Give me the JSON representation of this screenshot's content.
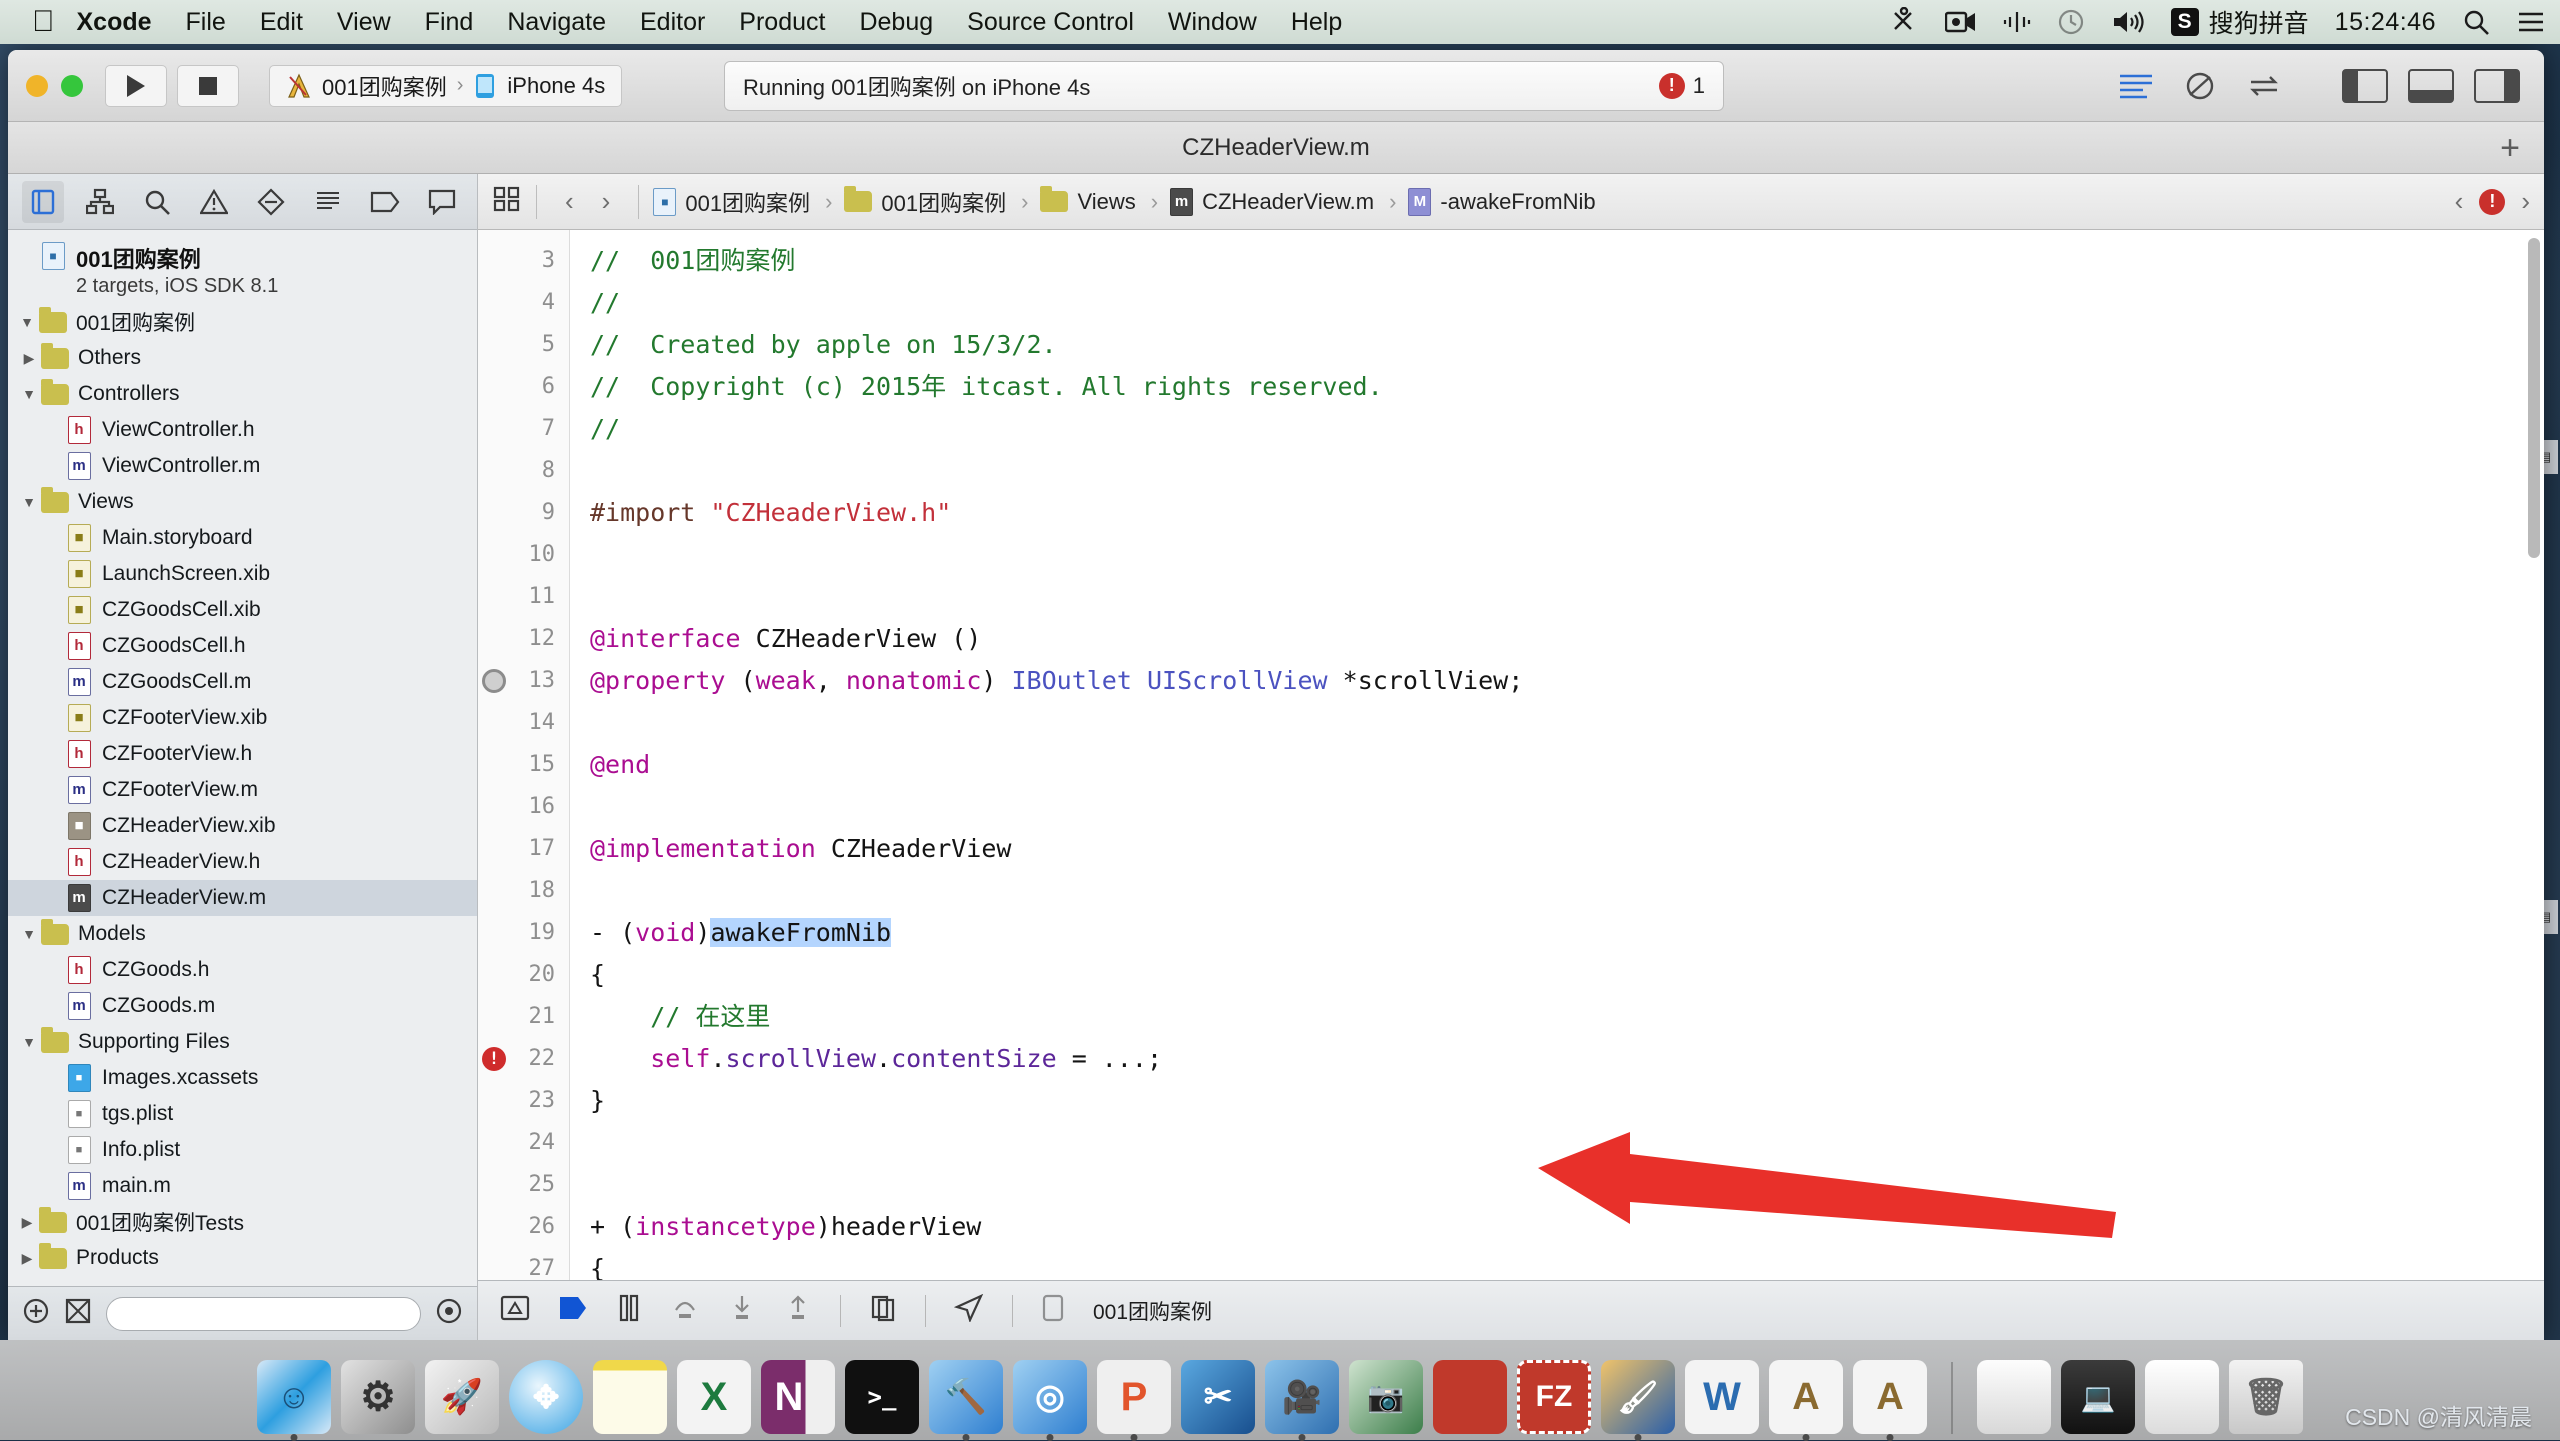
{
  "menubar": {
    "apple_icon": "apple-logo-icon",
    "items": [
      {
        "label": "Xcode",
        "bold": true
      },
      {
        "label": "File",
        "bold": false
      },
      {
        "label": "Edit",
        "bold": false
      },
      {
        "label": "View",
        "bold": false
      },
      {
        "label": "Find",
        "bold": false
      },
      {
        "label": "Navigate",
        "bold": false
      },
      {
        "label": "Editor",
        "bold": false
      },
      {
        "label": "Product",
        "bold": false
      },
      {
        "label": "Debug",
        "bold": false
      },
      {
        "label": "Source Control",
        "bold": false
      },
      {
        "label": "Window",
        "bold": false
      },
      {
        "label": "Help",
        "bold": false
      }
    ],
    "status": {
      "icons": [
        "scissors-icon",
        "screen-record-icon",
        "airplay-icon",
        "time-machine-icon",
        "volume-icon"
      ],
      "input_method_badge": "S",
      "input_method_label": "搜狗拼音",
      "clock": "15:24:46",
      "search_icon": "spotlight-search-icon",
      "notification_icon": "notification-center-icon"
    }
  },
  "toolbar": {
    "run_icon": "run-play-icon",
    "stop_icon": "stop-square-icon",
    "scheme_project": "001团购案例",
    "scheme_device": "iPhone 4s",
    "scheme_chevron": "›",
    "status_text": "Running 001团购案例 on iPhone 4s",
    "error_count": "1",
    "error_badge_glyph": "!",
    "editor_icons": [
      "standard-editor-icon",
      "assistant-editor-icon",
      "version-editor-icon"
    ],
    "pane_icons": [
      "toggle-navigator-icon",
      "toggle-debug-area-icon",
      "toggle-utilities-icon"
    ]
  },
  "titlebar": {
    "title": "CZHeaderView.m",
    "add_tab_label": "+"
  },
  "navigator": {
    "tabs": [
      {
        "name": "project-navigator-tab",
        "active": true
      },
      {
        "name": "symbol-navigator-tab",
        "active": false
      },
      {
        "name": "find-navigator-tab",
        "active": false
      },
      {
        "name": "issue-navigator-tab",
        "active": false
      },
      {
        "name": "test-navigator-tab",
        "active": false
      },
      {
        "name": "debug-navigator-tab",
        "active": false
      },
      {
        "name": "breakpoint-navigator-tab",
        "active": false
      },
      {
        "name": "log-navigator-tab",
        "active": false
      }
    ],
    "project_name": "001团购案例",
    "project_subtitle": "2 targets, iOS SDK 8.1",
    "tree": [
      {
        "label": "001团购案例",
        "kind": "folder",
        "indent": 0,
        "twisty": "down",
        "selected": false
      },
      {
        "label": "Others",
        "kind": "folder",
        "indent": 1,
        "twisty": "right",
        "selected": false
      },
      {
        "label": "Controllers",
        "kind": "folder",
        "indent": 1,
        "twisty": "down",
        "selected": false
      },
      {
        "label": "ViewController.h",
        "kind": "h",
        "indent": 2,
        "twisty": "",
        "selected": false
      },
      {
        "label": "ViewController.m",
        "kind": "m",
        "indent": 2,
        "twisty": "",
        "selected": false
      },
      {
        "label": "Views",
        "kind": "folder",
        "indent": 1,
        "twisty": "down",
        "selected": false
      },
      {
        "label": "Main.storyboard",
        "kind": "sb",
        "indent": 2,
        "twisty": "",
        "selected": false
      },
      {
        "label": "LaunchScreen.xib",
        "kind": "xib",
        "indent": 2,
        "twisty": "",
        "selected": false
      },
      {
        "label": "CZGoodsCell.xib",
        "kind": "xib",
        "indent": 2,
        "twisty": "",
        "selected": false
      },
      {
        "label": "CZGoodsCell.h",
        "kind": "h",
        "indent": 2,
        "twisty": "",
        "selected": false
      },
      {
        "label": "CZGoodsCell.m",
        "kind": "m",
        "indent": 2,
        "twisty": "",
        "selected": false
      },
      {
        "label": "CZFooterView.xib",
        "kind": "xib",
        "indent": 2,
        "twisty": "",
        "selected": false
      },
      {
        "label": "CZFooterView.h",
        "kind": "h",
        "indent": 2,
        "twisty": "",
        "selected": false
      },
      {
        "label": "CZFooterView.m",
        "kind": "m",
        "indent": 2,
        "twisty": "",
        "selected": false
      },
      {
        "label": "CZHeaderView.xib",
        "kind": "gray",
        "indent": 2,
        "twisty": "",
        "selected": false
      },
      {
        "label": "CZHeaderView.h",
        "kind": "h",
        "indent": 2,
        "twisty": "",
        "selected": false
      },
      {
        "label": "CZHeaderView.m",
        "kind": "dark",
        "indent": 2,
        "twisty": "",
        "selected": true
      },
      {
        "label": "Models",
        "kind": "folder",
        "indent": 1,
        "twisty": "down",
        "selected": false
      },
      {
        "label": "CZGoods.h",
        "kind": "h",
        "indent": 2,
        "twisty": "",
        "selected": false
      },
      {
        "label": "CZGoods.m",
        "kind": "m",
        "indent": 2,
        "twisty": "",
        "selected": false
      },
      {
        "label": "Supporting Files",
        "kind": "folder",
        "indent": 1,
        "twisty": "down",
        "selected": false
      },
      {
        "label": "Images.xcassets",
        "kind": "asset",
        "indent": 2,
        "twisty": "",
        "selected": false
      },
      {
        "label": "tgs.plist",
        "kind": "plist",
        "indent": 2,
        "twisty": "",
        "selected": false
      },
      {
        "label": "Info.plist",
        "kind": "plist",
        "indent": 2,
        "twisty": "",
        "selected": false
      },
      {
        "label": "main.m",
        "kind": "m",
        "indent": 2,
        "twisty": "",
        "selected": false
      },
      {
        "label": "001团购案例Tests",
        "kind": "folder",
        "indent": 0,
        "twisty": "right",
        "selected": false
      },
      {
        "label": "Products",
        "kind": "folder",
        "indent": 0,
        "twisty": "right",
        "selected": false
      }
    ],
    "filter_placeholder": "",
    "footer_icons": [
      "add-file-icon",
      "filter-icon",
      "recent-files-icon"
    ]
  },
  "jumpbar": {
    "related_items_icon": "related-items-icon",
    "back_icon": "‹",
    "forward_icon": "›",
    "crumbs": [
      {
        "label": "001团购案例",
        "icon": "project-icon"
      },
      {
        "label": "001团购案例",
        "icon": "folder-icon"
      },
      {
        "label": "Views",
        "icon": "folder-icon"
      },
      {
        "label": "CZHeaderView.m",
        "icon": "m-file-icon"
      },
      {
        "label": "-awakeFromNib",
        "icon": "method-icon"
      }
    ],
    "issue_prev_icon": "‹",
    "issue_count_glyph": "!",
    "issue_next_icon": "›"
  },
  "code": {
    "first_line_number": 3,
    "lines": [
      {
        "n": 3,
        "marker": "",
        "tokens": [
          {
            "t": "//  001团购案例",
            "c": "c-com"
          }
        ]
      },
      {
        "n": 4,
        "marker": "",
        "tokens": [
          {
            "t": "//",
            "c": "c-com"
          }
        ]
      },
      {
        "n": 5,
        "marker": "",
        "tokens": [
          {
            "t": "//  Created by apple on 15/3/2.",
            "c": "c-com"
          }
        ]
      },
      {
        "n": 6,
        "marker": "",
        "tokens": [
          {
            "t": "//  Copyright (c) 2015年 itcast. All rights reserved.",
            "c": "c-com"
          }
        ]
      },
      {
        "n": 7,
        "marker": "",
        "tokens": [
          {
            "t": "//",
            "c": "c-com"
          }
        ]
      },
      {
        "n": 8,
        "marker": "",
        "tokens": []
      },
      {
        "n": 9,
        "marker": "",
        "tokens": [
          {
            "t": "#import ",
            "c": "c-pre"
          },
          {
            "t": "\"CZHeaderView.h\"",
            "c": "c-str"
          }
        ]
      },
      {
        "n": 10,
        "marker": "",
        "tokens": []
      },
      {
        "n": 11,
        "marker": "",
        "tokens": []
      },
      {
        "n": 12,
        "marker": "",
        "tokens": [
          {
            "t": "@interface",
            "c": "c-kw"
          },
          {
            "t": " CZHeaderView ()",
            "c": "c-plain"
          }
        ]
      },
      {
        "n": 13,
        "marker": "brk",
        "tokens": [
          {
            "t": "@property",
            "c": "c-kw"
          },
          {
            "t": " (",
            "c": "c-plain"
          },
          {
            "t": "weak",
            "c": "c-kw"
          },
          {
            "t": ", ",
            "c": "c-plain"
          },
          {
            "t": "nonatomic",
            "c": "c-kw"
          },
          {
            "t": ") ",
            "c": "c-plain"
          },
          {
            "t": "IBOutlet",
            "c": "c-type"
          },
          {
            "t": " ",
            "c": "c-plain"
          },
          {
            "t": "UIScrollView",
            "c": "c-type"
          },
          {
            "t": " *scrollView;",
            "c": "c-plain"
          }
        ]
      },
      {
        "n": 14,
        "marker": "",
        "tokens": []
      },
      {
        "n": 15,
        "marker": "",
        "tokens": [
          {
            "t": "@end",
            "c": "c-kw"
          }
        ]
      },
      {
        "n": 16,
        "marker": "",
        "tokens": []
      },
      {
        "n": 17,
        "marker": "",
        "tokens": [
          {
            "t": "@implementation",
            "c": "c-kw"
          },
          {
            "t": " CZHeaderView",
            "c": "c-plain"
          }
        ]
      },
      {
        "n": 18,
        "marker": "",
        "tokens": []
      },
      {
        "n": 19,
        "marker": "",
        "tokens": [
          {
            "t": "- (",
            "c": "c-plain"
          },
          {
            "t": "void",
            "c": "c-kw"
          },
          {
            "t": ")",
            "c": "c-plain"
          },
          {
            "t": "awakeFromNib",
            "c": "c-plain c-sel"
          }
        ]
      },
      {
        "n": 20,
        "marker": "",
        "tokens": [
          {
            "t": "{",
            "c": "c-plain"
          }
        ]
      },
      {
        "n": 21,
        "marker": "",
        "tokens": [
          {
            "t": "    // 在这里",
            "c": "c-com"
          }
        ]
      },
      {
        "n": 22,
        "marker": "err",
        "tokens": [
          {
            "t": "    ",
            "c": "c-plain"
          },
          {
            "t": "self",
            "c": "c-kw"
          },
          {
            "t": ".",
            "c": "c-plain"
          },
          {
            "t": "scrollView",
            "c": "c-prop"
          },
          {
            "t": ".",
            "c": "c-plain"
          },
          {
            "t": "contentSize",
            "c": "c-prop"
          },
          {
            "t": " = ...;",
            "c": "c-plain"
          }
        ]
      },
      {
        "n": 23,
        "marker": "",
        "tokens": [
          {
            "t": "}",
            "c": "c-plain"
          }
        ]
      },
      {
        "n": 24,
        "marker": "",
        "tokens": []
      },
      {
        "n": 25,
        "marker": "",
        "tokens": []
      },
      {
        "n": 26,
        "marker": "",
        "tokens": [
          {
            "t": "+ (",
            "c": "c-plain"
          },
          {
            "t": "instancetype",
            "c": "c-kw"
          },
          {
            "t": ")headerView",
            "c": "c-plain"
          }
        ]
      },
      {
        "n": 27,
        "marker": "",
        "tokens": [
          {
            "t": "{",
            "c": "c-plain"
          }
        ]
      }
    ]
  },
  "annotation": {
    "arrow_color": "#e8302a",
    "arrow_name": "red-pointer-arrow"
  },
  "debugbar": {
    "icons": [
      "hide-debug-area-icon",
      "continue-icon",
      "pause-icon",
      "step-over-icon",
      "step-into-icon",
      "step-out-icon",
      "view-hierarchy-icon",
      "simulate-location-icon",
      "memory-gauge-icon"
    ],
    "process_label": "001团购案例"
  },
  "dock": {
    "items": [
      {
        "name": "finder",
        "glyph": "",
        "color": "#2e9fe0",
        "running": true
      },
      {
        "name": "system-preferences",
        "glyph": "",
        "color": "#9b9b9b",
        "running": false
      },
      {
        "name": "launchpad",
        "glyph": "",
        "color": "#c9c9c9",
        "running": false
      },
      {
        "name": "safari",
        "glyph": "",
        "color": "#3aa3e3",
        "running": false
      },
      {
        "name": "notes",
        "glyph": "",
        "color": "#f5e9a0",
        "running": false
      },
      {
        "name": "excel",
        "glyph": "X",
        "color": "#1d7a3e",
        "running": false
      },
      {
        "name": "onenote",
        "glyph": "N",
        "color": "#7b2d6b",
        "running": false
      },
      {
        "name": "terminal",
        "glyph": "",
        "color": "#111111",
        "running": false
      },
      {
        "name": "xcode",
        "glyph": "",
        "color": "#2f7fd0",
        "running": true
      },
      {
        "name": "instruments",
        "glyph": "",
        "color": "#2f7fd0",
        "running": true
      },
      {
        "name": "pages-question",
        "glyph": "P",
        "color": "#e2552c",
        "running": true
      },
      {
        "name": "snipping-tool",
        "glyph": "",
        "color": "#1e5fa8",
        "running": false
      },
      {
        "name": "quicktime",
        "glyph": "",
        "color": "#2f6fb0",
        "running": true
      },
      {
        "name": "image-capture",
        "glyph": "",
        "color": "#3c7e4a",
        "running": false
      },
      {
        "name": "stamp-app",
        "glyph": "",
        "color": "#c0392b",
        "running": false
      },
      {
        "name": "filezilla",
        "glyph": "FZ",
        "color": "#c0392b",
        "running": false
      },
      {
        "name": "paintbrush-app",
        "glyph": "",
        "color": "#e8a33d",
        "running": true
      },
      {
        "name": "word",
        "glyph": "W",
        "color": "#2b6cb0",
        "running": false
      },
      {
        "name": "font-book-a",
        "glyph": "A",
        "color": "#f0f0f0",
        "running": true
      },
      {
        "name": "font-book-a-2",
        "glyph": "A",
        "color": "#f0f0f0",
        "running": true
      }
    ],
    "stacks": [
      {
        "name": "documents-stack"
      },
      {
        "name": "downloads-stack"
      },
      {
        "name": "whiteboard-stack"
      },
      {
        "name": "trash",
        "glyph": ""
      }
    ]
  },
  "watermark": "CSDN @清风清晨"
}
